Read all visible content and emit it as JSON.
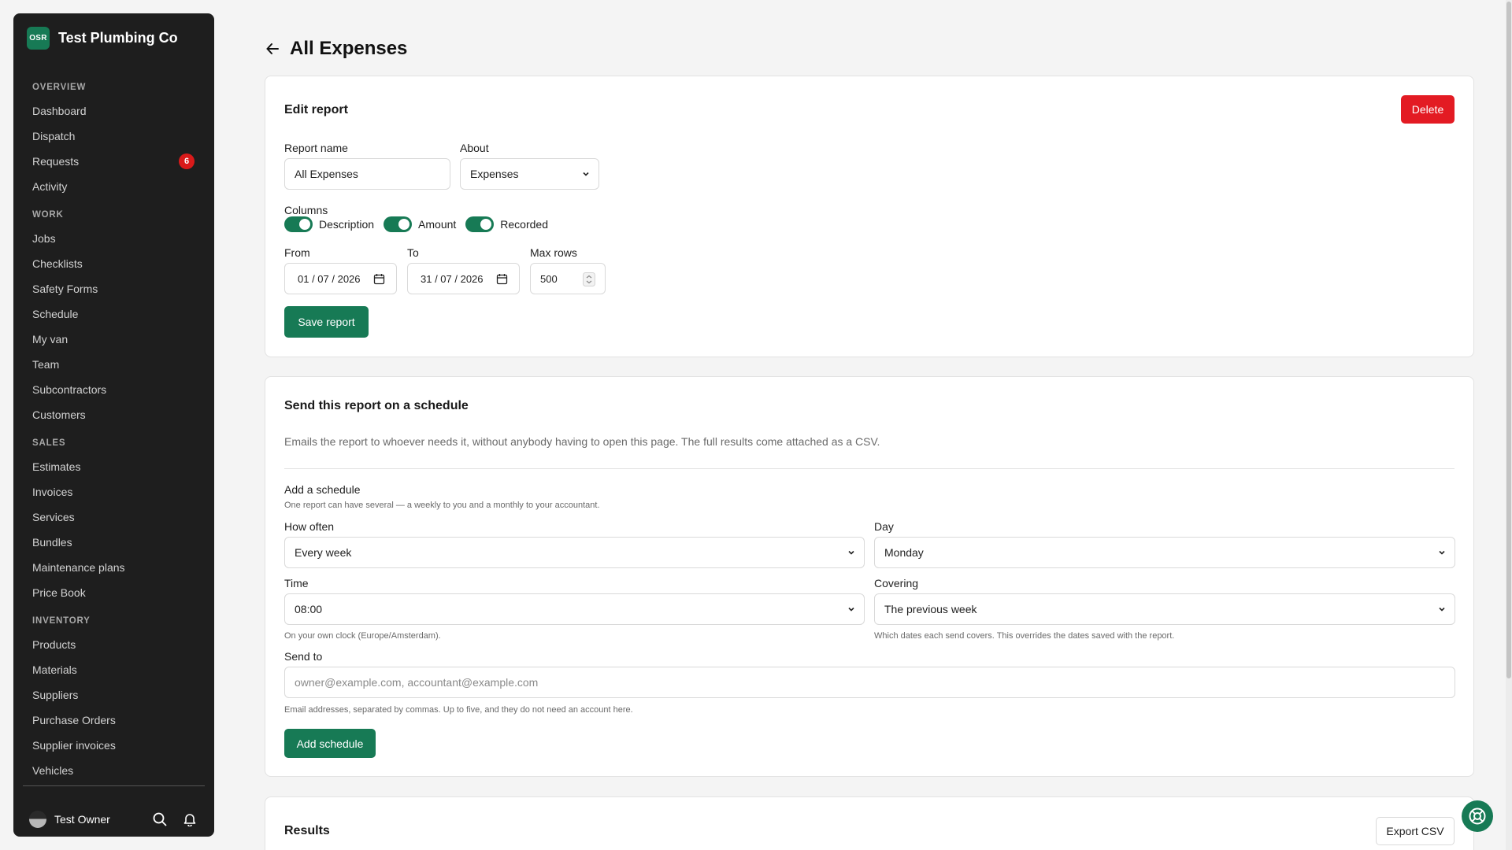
{
  "brand": {
    "logo_text": "OSR",
    "name": "Test Plumbing Co"
  },
  "sidebar": {
    "sections": [
      {
        "title": "OVERVIEW",
        "items": [
          {
            "label": "Dashboard"
          },
          {
            "label": "Dispatch"
          },
          {
            "label": "Requests",
            "badge": "6"
          },
          {
            "label": "Activity"
          }
        ]
      },
      {
        "title": "WORK",
        "items": [
          {
            "label": "Jobs"
          },
          {
            "label": "Checklists"
          },
          {
            "label": "Safety Forms"
          },
          {
            "label": "Schedule"
          },
          {
            "label": "My van"
          },
          {
            "label": "Team"
          },
          {
            "label": "Subcontractors"
          },
          {
            "label": "Customers"
          }
        ]
      },
      {
        "title": "SALES",
        "items": [
          {
            "label": "Estimates"
          },
          {
            "label": "Invoices"
          },
          {
            "label": "Services"
          },
          {
            "label": "Bundles"
          },
          {
            "label": "Maintenance plans"
          },
          {
            "label": "Price Book"
          }
        ]
      },
      {
        "title": "INVENTORY",
        "items": [
          {
            "label": "Products"
          },
          {
            "label": "Materials"
          },
          {
            "label": "Suppliers"
          },
          {
            "label": "Purchase Orders"
          },
          {
            "label": "Supplier invoices"
          },
          {
            "label": "Vehicles"
          }
        ]
      }
    ],
    "footer": {
      "user_name": "Test Owner",
      "search_icon": "search-icon",
      "bell_icon": "bell-icon"
    }
  },
  "page": {
    "title": "All Expenses",
    "back_icon": "arrow-left-icon"
  },
  "edit_report": {
    "title": "Edit report",
    "delete_label": "Delete",
    "report_name_label": "Report name",
    "report_name_value": "All Expenses",
    "about_label": "About",
    "about_value": "Expenses",
    "columns_label": "Columns",
    "columns": [
      {
        "label": "Description",
        "enabled": true
      },
      {
        "label": "Amount",
        "enabled": true
      },
      {
        "label": "Recorded",
        "enabled": true
      }
    ],
    "from_label": "From",
    "from_value": "01 / 07 / 2026",
    "to_label": "To",
    "to_value": "31 / 07 / 2026",
    "max_rows_label": "Max rows",
    "max_rows_value": "500",
    "save_label": "Save report"
  },
  "schedule": {
    "title": "Send this report on a schedule",
    "description": "Emails the report to whoever needs it, without anybody having to open this page. The full results come attached as a CSV.",
    "add_title": "Add a schedule",
    "add_help": "One report can have several — a weekly to you and a monthly to your accountant.",
    "how_often_label": "How often",
    "how_often_value": "Every week",
    "day_label": "Day",
    "day_value": "Monday",
    "time_label": "Time",
    "time_value": "08:00",
    "time_help": "On your own clock (Europe/Amsterdam).",
    "covering_label": "Covering",
    "covering_value": "The previous week",
    "covering_help": "Which dates each send covers. This overrides the dates saved with the report.",
    "send_to_label": "Send to",
    "send_to_placeholder": "owner@example.com, accountant@example.com",
    "send_to_help": "Email addresses, separated by commas. Up to five, and they do not need an account here.",
    "add_label": "Add schedule"
  },
  "results": {
    "title": "Results",
    "export_label": "Export CSV"
  },
  "colors": {
    "primary": "#177a55",
    "danger": "#e31b23",
    "sidebar_bg": "#1e1e1e",
    "badge": "#d91a1a"
  }
}
